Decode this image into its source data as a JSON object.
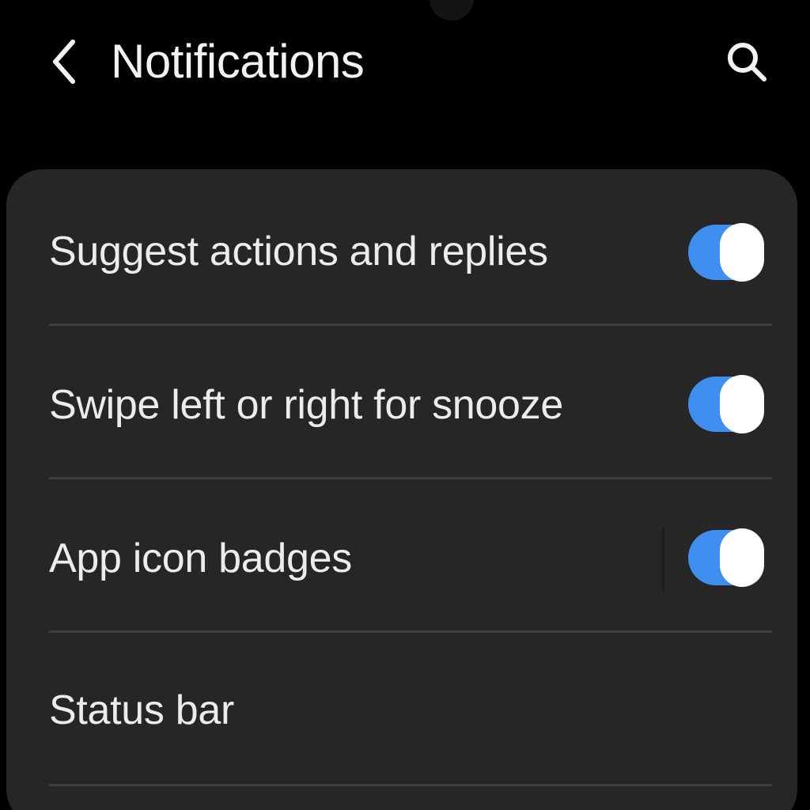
{
  "header": {
    "title": "Notifications",
    "back_icon": "chevron-left-icon",
    "search_icon": "search-icon"
  },
  "settings": [
    {
      "label": "Suggest actions and replies",
      "toggle": true
    },
    {
      "label": "Swipe left or right for snooze",
      "toggle": true
    },
    {
      "label": "App icon badges",
      "toggle": true
    },
    {
      "label": "Status bar"
    }
  ],
  "colors": {
    "background": "#000000",
    "card": "#262626",
    "accent": "#3e8ff0",
    "text": "#ececec"
  }
}
